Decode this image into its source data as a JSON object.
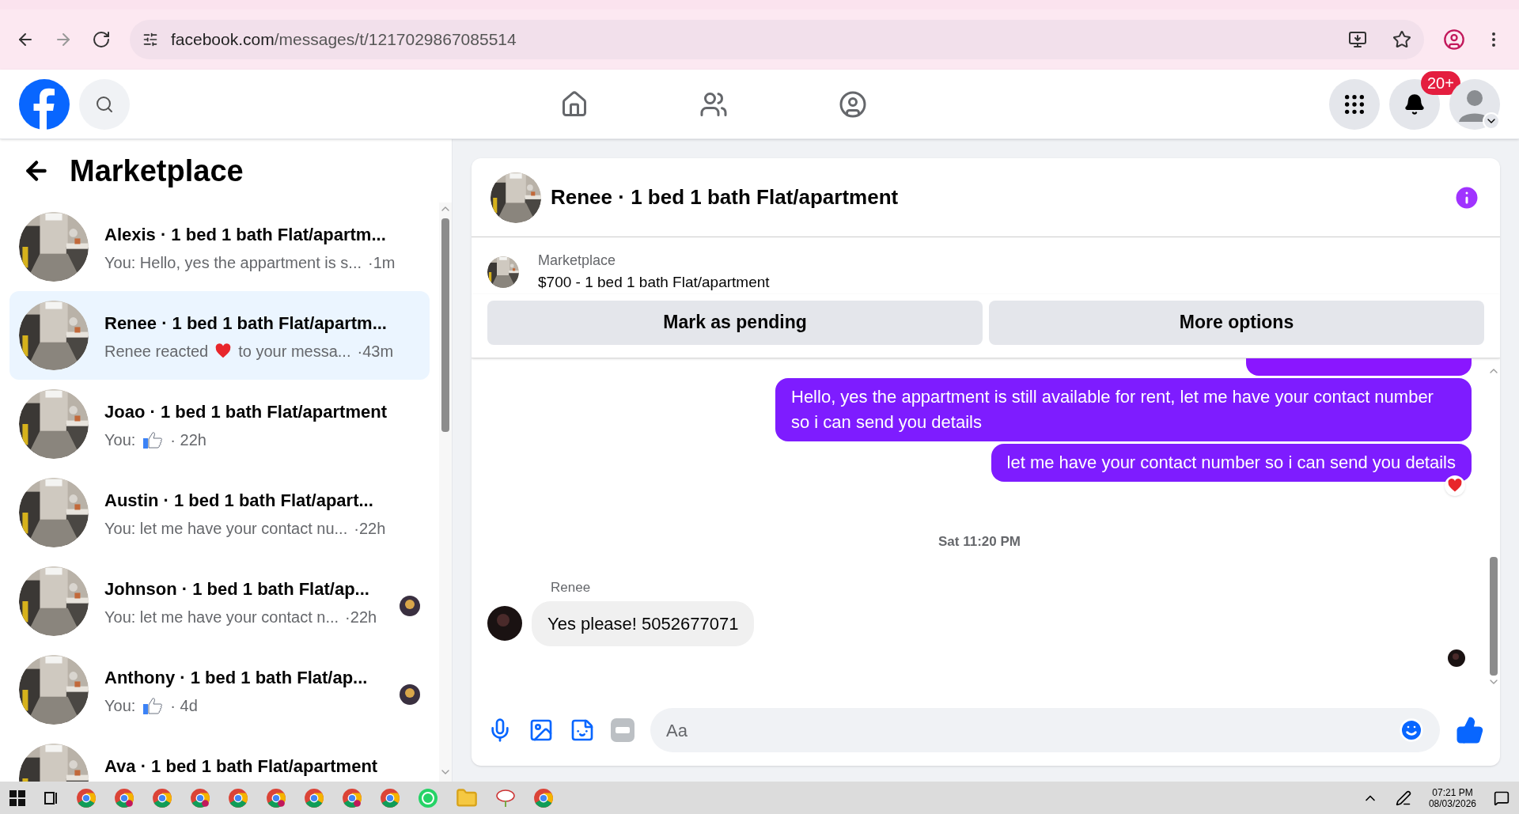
{
  "browser": {
    "url_domain": "facebook.com",
    "url_path": "/messages/t/1217029867085514"
  },
  "header": {
    "notification_badge": "20+"
  },
  "sidebar": {
    "title": "Marketplace",
    "conversations": [
      {
        "name": "Alexis · 1 bed 1 bath Flat/apartm...",
        "kind": "text",
        "preview": "You: Hello, yes the appartment is s...",
        "time": "·1m",
        "selected": false
      },
      {
        "name": "Renee · 1 bed 1 bath Flat/apartm...",
        "kind": "reaction",
        "preview": "Renee reacted",
        "preview_after": "to your messa...",
        "time": "·43m",
        "selected": true
      },
      {
        "name": "Joao · 1 bed 1 bath Flat/apartment",
        "kind": "like",
        "preview": "You:",
        "time": "· 22h",
        "selected": false
      },
      {
        "name": "Austin · 1 bed 1 bath Flat/apart...",
        "kind": "text",
        "preview": "You: let me have your contact nu...",
        "time": "·22h",
        "selected": false
      },
      {
        "name": "Johnson · 1 bed 1 bath Flat/ap...",
        "kind": "text",
        "preview": "You: let me have your contact n...",
        "time": "·22h",
        "selected": false,
        "seen": true
      },
      {
        "name": "Anthony · 1 bed 1 bath Flat/ap...",
        "kind": "like",
        "preview": "You:",
        "time": "· 4d",
        "selected": false,
        "seen": true
      },
      {
        "name": "Ava · 1 bed 1 bath Flat/apartment",
        "selected": false
      }
    ]
  },
  "chat": {
    "title": "Renee · 1 bed 1 bath Flat/apartment",
    "listing": {
      "label": "Marketplace",
      "title": "$700 - 1 bed 1 bath Flat/apartment"
    },
    "buttons": [
      "Mark as pending",
      "More options"
    ],
    "messages": [
      {
        "kind": "outgoing",
        "text": "Hello, yes the appartment is still available for rent, let me have your contact number so i can send you details"
      },
      {
        "kind": "outgoing",
        "text": "let me have your contact number so i can send you details",
        "reacted": true
      },
      {
        "kind": "timestamp",
        "text": "Sat 11:20 PM"
      },
      {
        "kind": "incoming",
        "sender": "Renee",
        "text": "Yes please! 5052677071"
      }
    ],
    "composer": {
      "placeholder": "Aa"
    }
  },
  "taskbar": {
    "apps": [
      {
        "kind": "windows"
      },
      {
        "kind": "taskview"
      },
      {
        "kind": "chrome"
      },
      {
        "kind": "chrome"
      },
      {
        "kind": "chrome"
      },
      {
        "kind": "chrome"
      },
      {
        "kind": "chrome"
      },
      {
        "kind": "chrome"
      },
      {
        "kind": "chrome"
      },
      {
        "kind": "chrome"
      },
      {
        "kind": "chrome"
      },
      {
        "kind": "whatsapp"
      },
      {
        "kind": "folder"
      },
      {
        "kind": "paint"
      },
      {
        "kind": "chrome"
      }
    ],
    "time": "07:21 PM",
    "date": "08/03/2026"
  }
}
